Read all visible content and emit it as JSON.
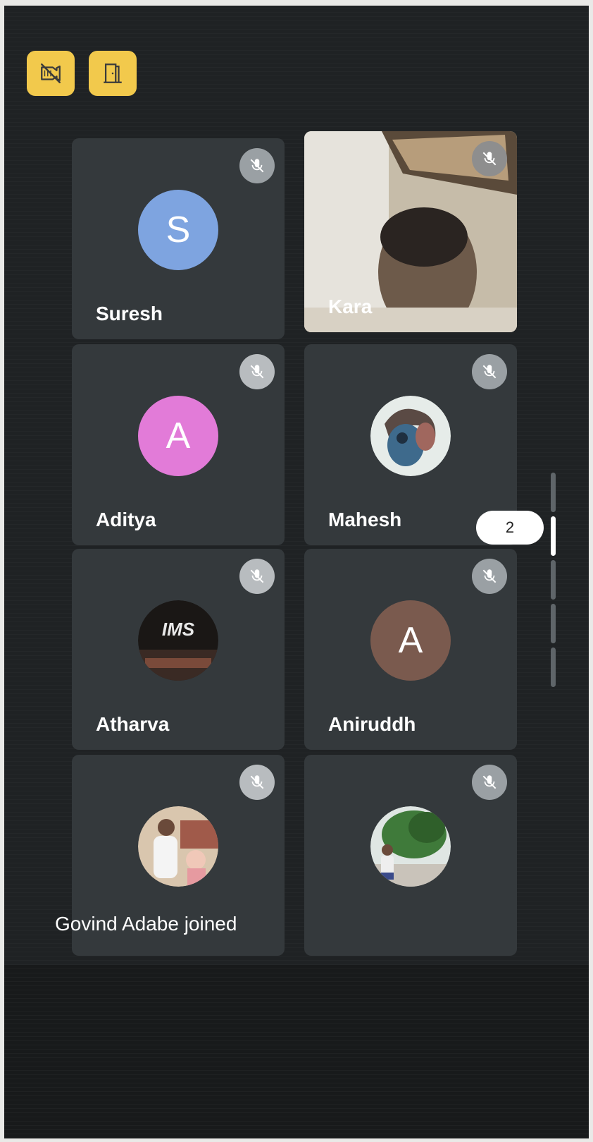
{
  "toolbar": {
    "icons": [
      "camera-off-icon",
      "exit-door-icon"
    ],
    "button_color": "#f2c94c"
  },
  "participants": [
    {
      "name": "Suresh",
      "avatar_type": "initial",
      "initial": "S",
      "avatar_color": "#7ea4e0",
      "muted": true
    },
    {
      "name": "Kara",
      "avatar_type": "video",
      "muted": true
    },
    {
      "name": "Aditya",
      "avatar_type": "initial",
      "initial": "A",
      "avatar_color": "#e27bd8",
      "muted": true
    },
    {
      "name": "Mahesh",
      "avatar_type": "photo",
      "muted": true
    },
    {
      "name": "Atharva",
      "avatar_type": "photo",
      "photo_text": "IMS",
      "muted": true
    },
    {
      "name": "Aniruddh",
      "avatar_type": "initial",
      "initial": "A",
      "avatar_color": "#7a5a4e",
      "muted": true
    },
    {
      "name": "",
      "avatar_type": "photo",
      "muted": true
    },
    {
      "name": "",
      "avatar_type": "photo",
      "muted": true
    }
  ],
  "pagination": {
    "current_page": "2"
  },
  "notification": {
    "text": "Govind Adabe joined"
  }
}
